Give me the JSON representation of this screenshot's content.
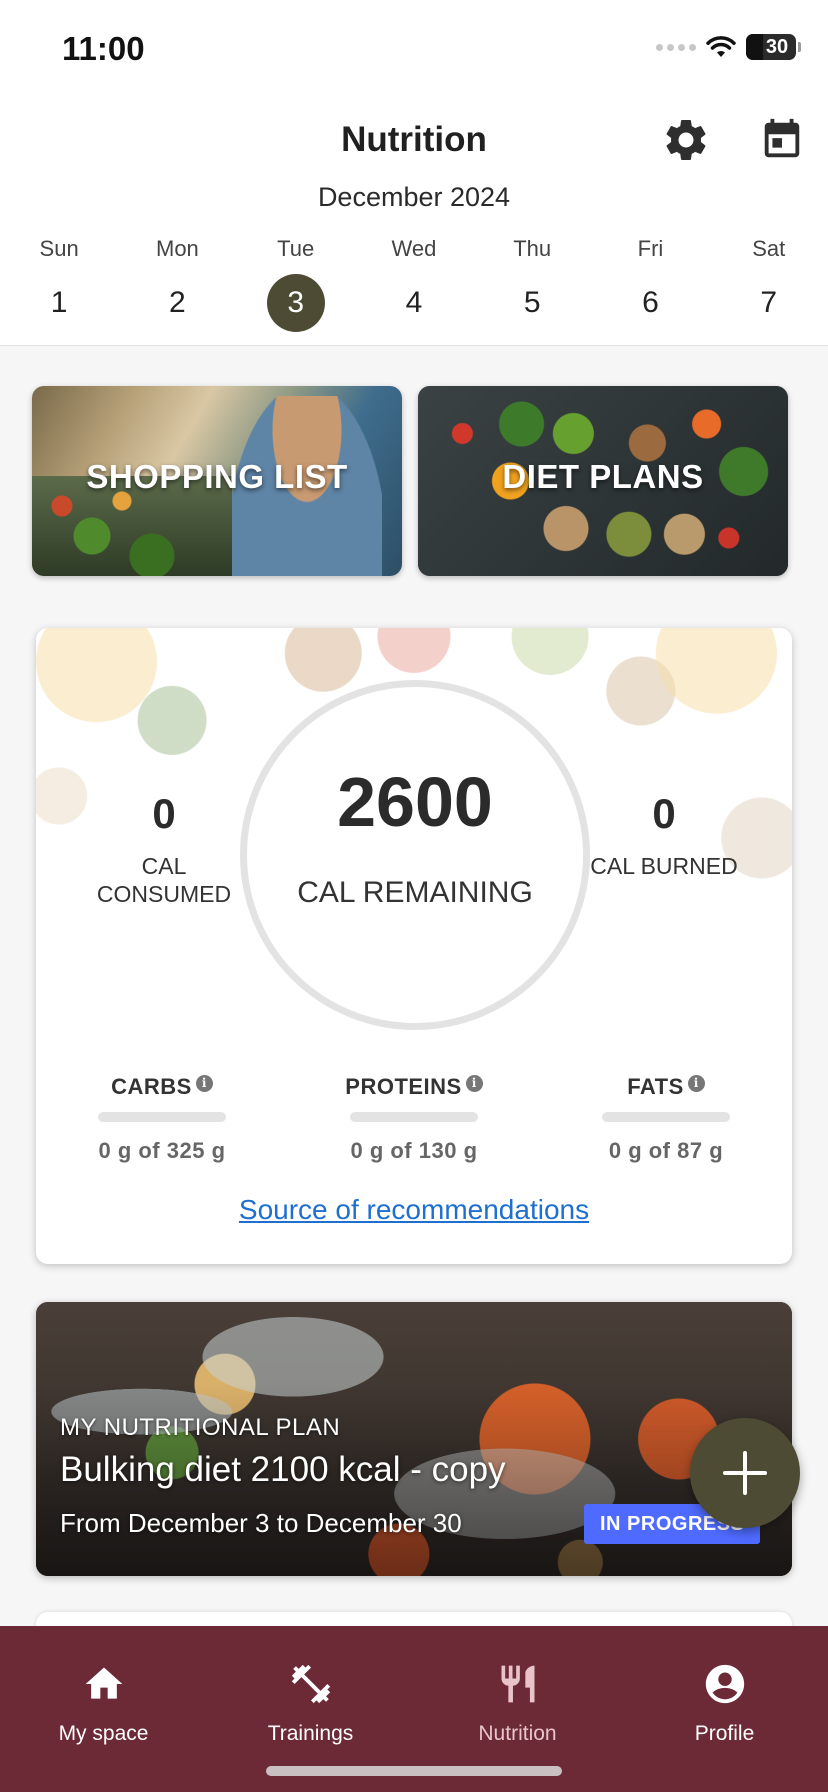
{
  "status_bar": {
    "time": "11:00",
    "battery": "30"
  },
  "header": {
    "title": "Nutrition",
    "month": "December 2024",
    "icons": {
      "settings": "gear-icon",
      "calendar": "calendar-icon"
    },
    "days": [
      {
        "name": "Sun",
        "num": "1"
      },
      {
        "name": "Mon",
        "num": "2"
      },
      {
        "name": "Tue",
        "num": "3"
      },
      {
        "name": "Wed",
        "num": "4"
      },
      {
        "name": "Thu",
        "num": "5"
      },
      {
        "name": "Fri",
        "num": "6"
      },
      {
        "name": "Sat",
        "num": "7"
      }
    ],
    "selected_day": "3"
  },
  "tiles": {
    "shopping": "SHOPPING LIST",
    "diet": "DIET PLANS"
  },
  "calories": {
    "consumed": "0",
    "consumed_label": "CAL CONSUMED",
    "remaining": "2600",
    "remaining_label": "CAL REMAINING",
    "burned": "0",
    "burned_label": "CAL BURNED"
  },
  "macros": [
    {
      "name": "CARBS",
      "value": "0 g of 325 g",
      "progress": 0
    },
    {
      "name": "PROTEINS",
      "value": "0 g of 130 g",
      "progress": 0
    },
    {
      "name": "FATS",
      "value": "0 g of 87 g",
      "progress": 0
    }
  ],
  "source_link": "Source of recommendations",
  "plan": {
    "kicker": "MY NUTRITIONAL PLAN",
    "title": "Bulking diet 2100 kcal - copy",
    "dates": "From December 3 to December 30",
    "status": "IN PROGRESS"
  },
  "nav": [
    {
      "label": "My space",
      "icon": "home-icon"
    },
    {
      "label": "Trainings",
      "icon": "dumbbell-icon"
    },
    {
      "label": "Nutrition",
      "icon": "fork-knife-icon",
      "active": true
    },
    {
      "label": "Profile",
      "icon": "profile-icon"
    }
  ],
  "colors": {
    "accent": "#4d4b34",
    "nav_bg": "#6c2a37",
    "link": "#1e6fd0",
    "badge": "#4f6bff"
  }
}
